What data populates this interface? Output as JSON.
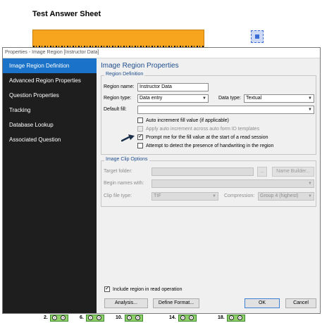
{
  "sheet": {
    "title": "Test Answer Sheet"
  },
  "bottom_questions": [
    {
      "num": "2."
    },
    {
      "num": "6."
    },
    {
      "num": "10."
    },
    {
      "num": "14."
    },
    {
      "num": "18."
    }
  ],
  "bubble_labels": {
    "true": "T",
    "false": "F"
  },
  "dialog": {
    "title": "Properties - Image Region [Instructor Data]",
    "nav": [
      "Image Region Definition",
      "Advanced Region Properties",
      "Question Properties",
      "Tracking",
      "Database Lookup",
      "Associated Question"
    ],
    "section_title": "Image Region Properties",
    "region_definition": {
      "group_label": "Region Definition",
      "region_name_label": "Region name:",
      "region_name_value": "Instructor Data",
      "region_type_label": "Region type:",
      "region_type_value": "Data entry",
      "data_type_label": "Data type:",
      "data_type_value": "Textual",
      "default_fill_label": "Default fill:",
      "default_fill_value": "",
      "checkboxes": [
        {
          "label": "Auto increment fill value (if applicable)",
          "checked": false,
          "enabled": true
        },
        {
          "label": "Apply auto increment across auto form ID templates",
          "checked": false,
          "enabled": false
        },
        {
          "label": "Prompt me for the fill value at the start of a read session",
          "checked": true,
          "enabled": true
        },
        {
          "label": "Attempt to detect the presence of handwriting in the region",
          "checked": false,
          "enabled": true
        }
      ]
    },
    "image_clip": {
      "group_label": "Image Clip Options",
      "target_folder_label": "Target folder:",
      "target_folder_value": "",
      "browse_label": "...",
      "name_builder_label": "Name Builder...",
      "region_names_label": "Begin names with:",
      "region_names_value": "",
      "clip_type_label": "Clip file type:",
      "clip_type_value": "TIF",
      "compression_label": "Compression:",
      "compression_value": "Group 4 (highest)"
    },
    "include_label": "Include region in read operation",
    "buttons": {
      "analysis": "Analysis...",
      "define_format": "Define Format...",
      "ok": "OK",
      "cancel": "Cancel"
    }
  },
  "colors": {
    "nav_bg": "#1e1e1e",
    "nav_active": "#1a73c9",
    "heading": "#1e4d8c",
    "barcode": "#f7a51e",
    "answer_box": "#8fd06a"
  }
}
